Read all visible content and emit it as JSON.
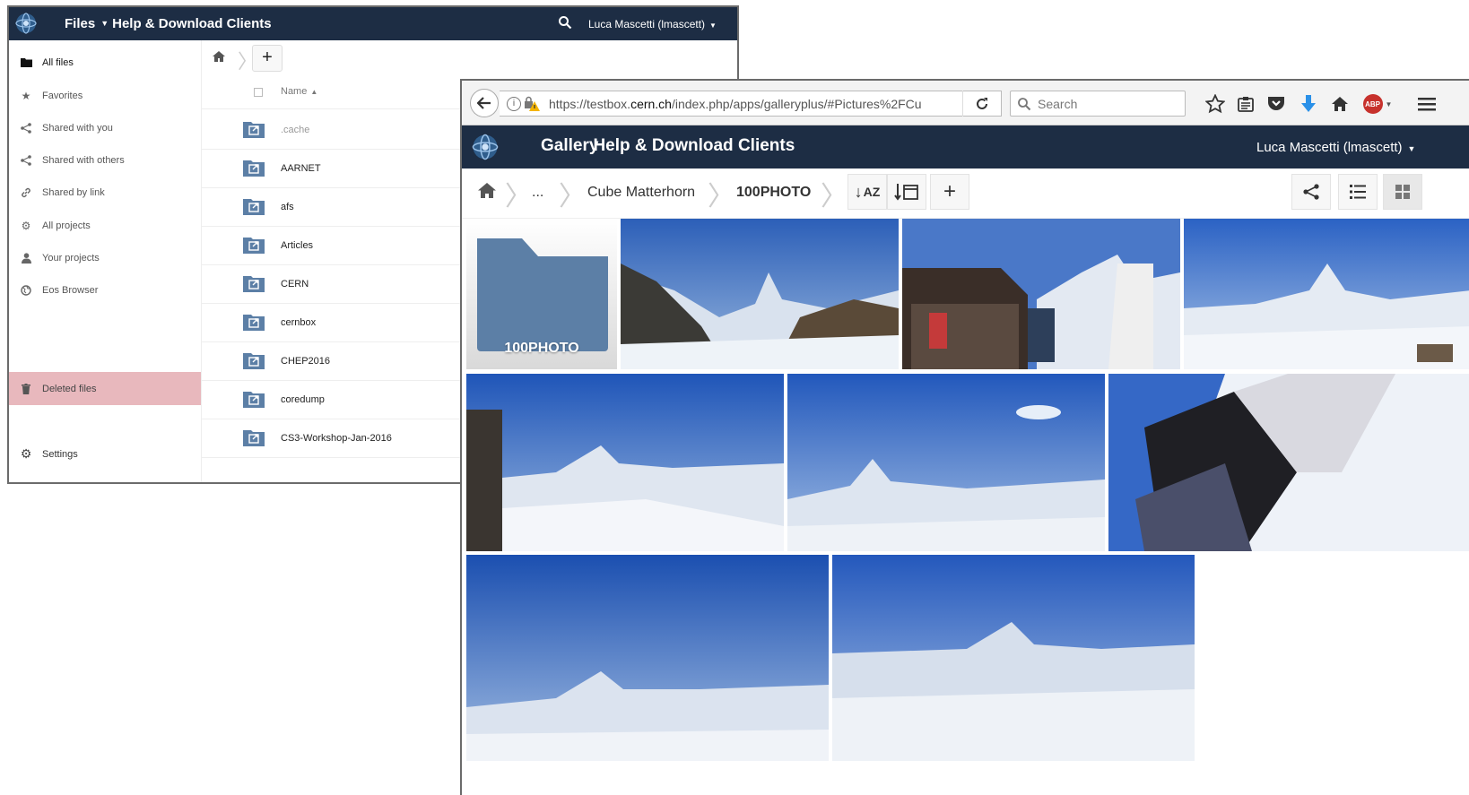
{
  "files_window": {
    "header": {
      "app_name": "Files",
      "app_menu": "Help & Download Clients",
      "user": "Luca Mascetti (lmascett)"
    },
    "sidebar": {
      "items": [
        {
          "label": "All files",
          "icon": "folder-icon"
        },
        {
          "label": "Favorites",
          "icon": "star-icon"
        },
        {
          "label": "Shared with you",
          "icon": "share-icon"
        },
        {
          "label": "Shared with others",
          "icon": "share-icon"
        },
        {
          "label": "Shared by link",
          "icon": "link-icon"
        },
        {
          "label": "All projects",
          "icon": "gear-icon"
        },
        {
          "label": "Your projects",
          "icon": "user-icon"
        },
        {
          "label": "Eos Browser",
          "icon": "globe-icon"
        }
      ],
      "deleted": "Deleted files",
      "settings": "Settings"
    },
    "list": {
      "column_name": "Name",
      "rows": [
        ".cache",
        "AARNET",
        "afs",
        "Articles",
        "CERN",
        "cernbox",
        "CHEP2016",
        "coredump",
        "CS3-Workshop-Jan-2016"
      ]
    }
  },
  "browser": {
    "url_host_prefix": "https://testbox.",
    "url_host_main": "cern.ch",
    "url_path": "/index.php/apps/galleryplus/#Pictures%2FCu",
    "search_placeholder": "Search",
    "abp_label": "ABP"
  },
  "gallery": {
    "header": {
      "app_name": "Gallery",
      "app_menu": "Help & Download Clients",
      "user": "Luca Mascetti (lmascett)"
    },
    "breadcrumbs": [
      "...",
      "Cube Matterhorn",
      "100PHOTO"
    ],
    "sort_label": "AZ",
    "folder_tile_label": "100PHOTO"
  },
  "colors": {
    "header_bg": "#1d2d44",
    "folder_icon": "#5c7fa6",
    "deleted_bg": "#e8b8bd"
  }
}
